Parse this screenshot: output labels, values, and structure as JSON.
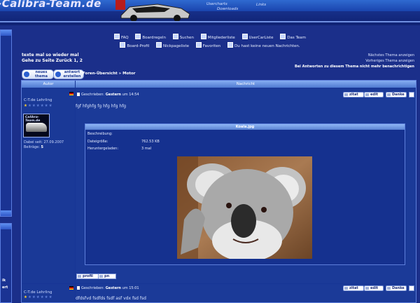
{
  "header": {
    "logo_text": "-Calibra-Team.de",
    "links": [
      "Downloads",
      "Links",
      "Usercharts"
    ]
  },
  "nav": {
    "row1": [
      "FAQ",
      "Boardregeln",
      "Suchen",
      "Mitgliederliste",
      "UserCarListe",
      "Das Team"
    ],
    "row2": [
      "Board-Profil",
      "Nickpageliste",
      "Favoriten",
      "Du hast keine neuen Nachrichten."
    ]
  },
  "topic": {
    "title": "texte mal so wieder mal",
    "goto": "Gehe zu Seite Zurück  1, 2",
    "next": "Nächstes Thema anzeigen",
    "prev": "Vorheriges Thema anzeigen",
    "notify": "Bei Antworten zu diesem Thema nicht mehr benachrichtigen"
  },
  "buttons": {
    "new_topic": "neues thema",
    "reply": "antwort erstellen",
    "quote": "zitat",
    "edit": "edit",
    "thanks": "Danke",
    "profile": "profil",
    "pn": "pn"
  },
  "breadcrumb": "Foren-Übersicht » Motor",
  "table": {
    "col_author": "Autor",
    "col_message": "Nachricht"
  },
  "post1": {
    "author": "C-T.de Lehrling",
    "stars": "★★★★★★",
    "avatar_text": "Calibra-Team.de",
    "joined_label": "Dabei seit:",
    "joined": "27.09.2007",
    "posts_label": "Beiträge:",
    "posts": "5",
    "written_label": "Geschrieben:",
    "written_day": "Gestern",
    "written_time": "um 14:54",
    "text": "fgf hfghfg fg hfg hfg hfg",
    "attachment": {
      "title": "Koala.jpg",
      "desc_label": "Beschreibung:",
      "file_label": "Dateigröße:",
      "file_size": "762.53 KB",
      "dl_label": "Heruntergeladen:",
      "dl_count": "3 mal"
    }
  },
  "post2": {
    "author": "C-T.de Lehrling",
    "written_label": "Geschrieben:",
    "written_day": "Gestern",
    "written_time": "um 15:01",
    "text": "dfdsfvd fsdfds fsdf asf vdx fsd fsd"
  },
  "left_panel": {
    "frag1": "ik",
    "frag2": "ert"
  }
}
